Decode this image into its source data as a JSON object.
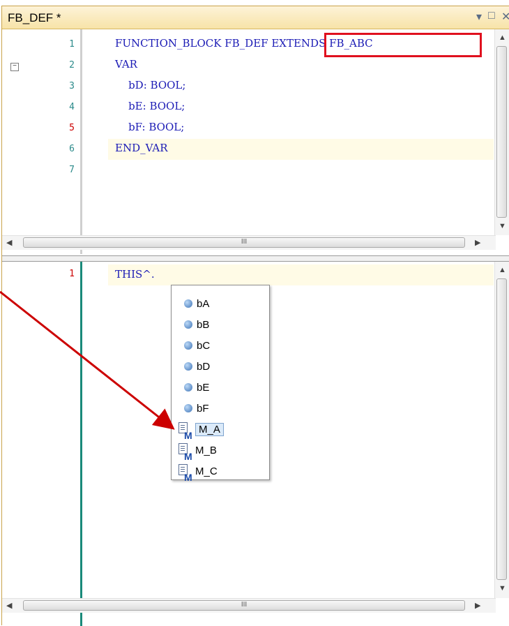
{
  "window": {
    "title": "FB_DEF *"
  },
  "top_editor": {
    "line_numbers": [
      "1",
      "2",
      "3",
      "4",
      "5",
      "6",
      "7"
    ],
    "lines": [
      {
        "a": "FUNCTION_BLOCK FB_DEF ",
        "b": "EXTENDS FB_ABC"
      },
      {
        "a": "VAR"
      },
      {
        "a": "    bD: BOOL;"
      },
      {
        "a": "    bE: BOOL;"
      },
      {
        "a": "    bF: BOOL;"
      },
      {
        "a": "END_VAR"
      },
      {
        "a": ""
      }
    ]
  },
  "bottom_editor": {
    "line_numbers": [
      "1"
    ],
    "line1": "THIS^."
  },
  "autocomplete": {
    "items": [
      "bA",
      "bB",
      "bC",
      "bD",
      "bE",
      "bF",
      "M_A",
      "M_B",
      "M_C"
    ],
    "selected": "M_A"
  },
  "scrollbar": {
    "thumb_glyph": "III"
  },
  "colors": {
    "highlight_box": "#e0101e",
    "arrow": "#cc0000"
  }
}
